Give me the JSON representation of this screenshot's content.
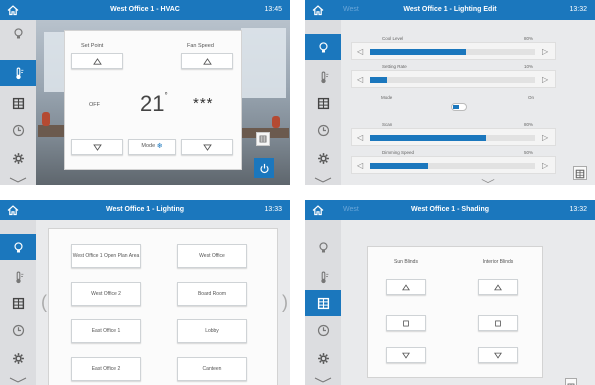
{
  "icons": {
    "home": "home-icon",
    "lighting": "lightbulb-icon",
    "hvac": "thermometer-icon",
    "shading": "blinds-icon",
    "schedule": "clock-icon",
    "settings": "gear-icon",
    "more": "chevron-down-icon"
  },
  "colors": {
    "accent": "#1b77bd",
    "sidebar": "#dcdde0",
    "panel_bg": "#e9eaec"
  },
  "hvac": {
    "title": "West Office 1 - HVAC",
    "time": "13:45",
    "set_point_label": "Set Point",
    "fan_speed_label": "Fan Speed",
    "temperature": "21",
    "degree_symbol": "°",
    "left_value": "OFF",
    "mode_label": "Mode",
    "fan_level": "***"
  },
  "lighting_edit": {
    "title": "West Office 1 - Lighting Edit",
    "faint_tab": "West",
    "time": "13:32",
    "sliders": [
      {
        "label": "Cool Level",
        "value": "80%",
        "level": 0.58
      },
      {
        "label": "Setting Rate",
        "value": "10%",
        "level": 0.1
      },
      {
        "label": "Scan",
        "value": "80%",
        "level": 0.7
      },
      {
        "label": "Dimming Speed",
        "value": "50%",
        "level": 0.35
      }
    ],
    "toggle": {
      "label": "Mode",
      "value": "On",
      "on": true
    }
  },
  "lighting": {
    "title": "West Office 1 - Lighting",
    "time": "13:33",
    "zones": [
      "West Office 1 Open Plan Area",
      "West Office",
      "West Office 2",
      "Board Room",
      "East Office 1",
      "Lobby",
      "East Office 2",
      "Canteen"
    ]
  },
  "shading": {
    "title": "West Office 1 - Shading",
    "faint_tab": "West",
    "time": "13:32",
    "columns": [
      "Sun Blinds",
      "Interior Blinds"
    ]
  }
}
